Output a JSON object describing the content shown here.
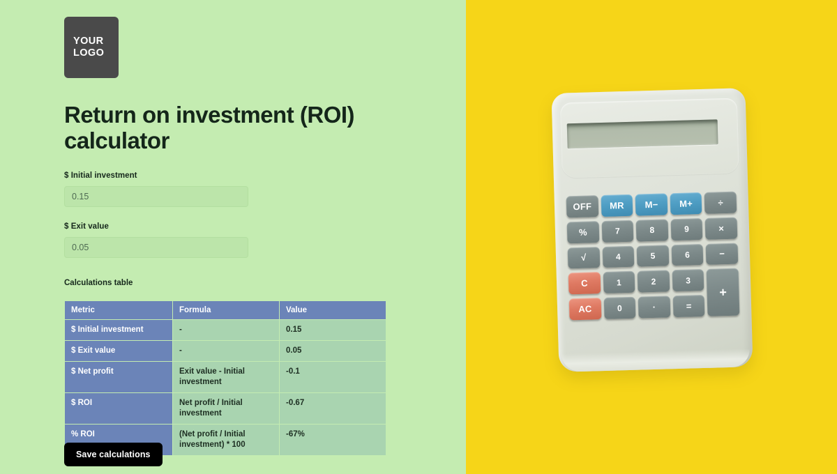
{
  "brand": {
    "logo_line1": "YOUR",
    "logo_line2": "LOGO"
  },
  "header": {
    "title": "Return on investment (ROI) calculator"
  },
  "form": {
    "fields": [
      {
        "label": "$ Initial investment",
        "value": "0.15",
        "placeholder": "0.15"
      },
      {
        "label": "$ Exit value",
        "value": "0.05",
        "placeholder": "0.05"
      }
    ]
  },
  "table": {
    "caption": "Calculations table",
    "columns": [
      "Metric",
      "Formula",
      "Value"
    ],
    "rows": [
      {
        "metric": "$ Initial investment",
        "formula": "-",
        "value": "0.15"
      },
      {
        "metric": "$ Exit value",
        "formula": "-",
        "value": "0.05"
      },
      {
        "metric": "$ Net profit",
        "formula": "Exit value - Initial investment",
        "value": "-0.1"
      },
      {
        "metric": "$ ROI",
        "formula": "Net profit / Initial investment",
        "value": "-0.67"
      },
      {
        "metric": "% ROI",
        "formula": "(Net profit / Initial investment) * 100",
        "value": "-67%"
      }
    ]
  },
  "actions": {
    "save_label": "Save calculations"
  },
  "photo": {
    "background_color": "#f6d518",
    "device": "pocket calculator",
    "display_value": "",
    "keys": [
      {
        "label": "OFF",
        "style": "gray",
        "kind": "op"
      },
      {
        "label": "MR",
        "style": "blue",
        "kind": "op"
      },
      {
        "label": "M−",
        "style": "blue",
        "kind": "op"
      },
      {
        "label": "M+",
        "style": "blue",
        "kind": "op"
      },
      {
        "label": "÷",
        "style": "gray",
        "kind": "op"
      },
      {
        "label": "%",
        "style": "gray",
        "kind": "op"
      },
      {
        "label": "7",
        "style": "gray",
        "kind": "digit"
      },
      {
        "label": "8",
        "style": "gray",
        "kind": "digit"
      },
      {
        "label": "9",
        "style": "gray",
        "kind": "digit"
      },
      {
        "label": "×",
        "style": "gray",
        "kind": "op"
      },
      {
        "label": "√",
        "style": "gray",
        "kind": "op"
      },
      {
        "label": "4",
        "style": "gray",
        "kind": "digit"
      },
      {
        "label": "5",
        "style": "gray",
        "kind": "digit"
      },
      {
        "label": "6",
        "style": "gray",
        "kind": "digit"
      },
      {
        "label": "−",
        "style": "gray",
        "kind": "op"
      },
      {
        "label": "C",
        "style": "red",
        "kind": "op"
      },
      {
        "label": "1",
        "style": "gray",
        "kind": "digit"
      },
      {
        "label": "2",
        "style": "gray",
        "kind": "digit"
      },
      {
        "label": "3",
        "style": "gray",
        "kind": "digit"
      },
      {
        "label": "+",
        "style": "gray",
        "kind": "plus"
      },
      {
        "label": "AC",
        "style": "red",
        "kind": "op"
      },
      {
        "label": "0",
        "style": "gray",
        "kind": "digit"
      },
      {
        "label": "·",
        "style": "gray",
        "kind": "op"
      },
      {
        "label": "=",
        "style": "gray",
        "kind": "op"
      }
    ]
  },
  "colors": {
    "page_background": "#c4ecb1",
    "photo_background": "#f6d518",
    "table_header": "#6b84b8",
    "table_cell": "#a9d4b0",
    "logo_background": "#4a4a4a",
    "button_background": "#000000",
    "title_text": "#14261a"
  }
}
